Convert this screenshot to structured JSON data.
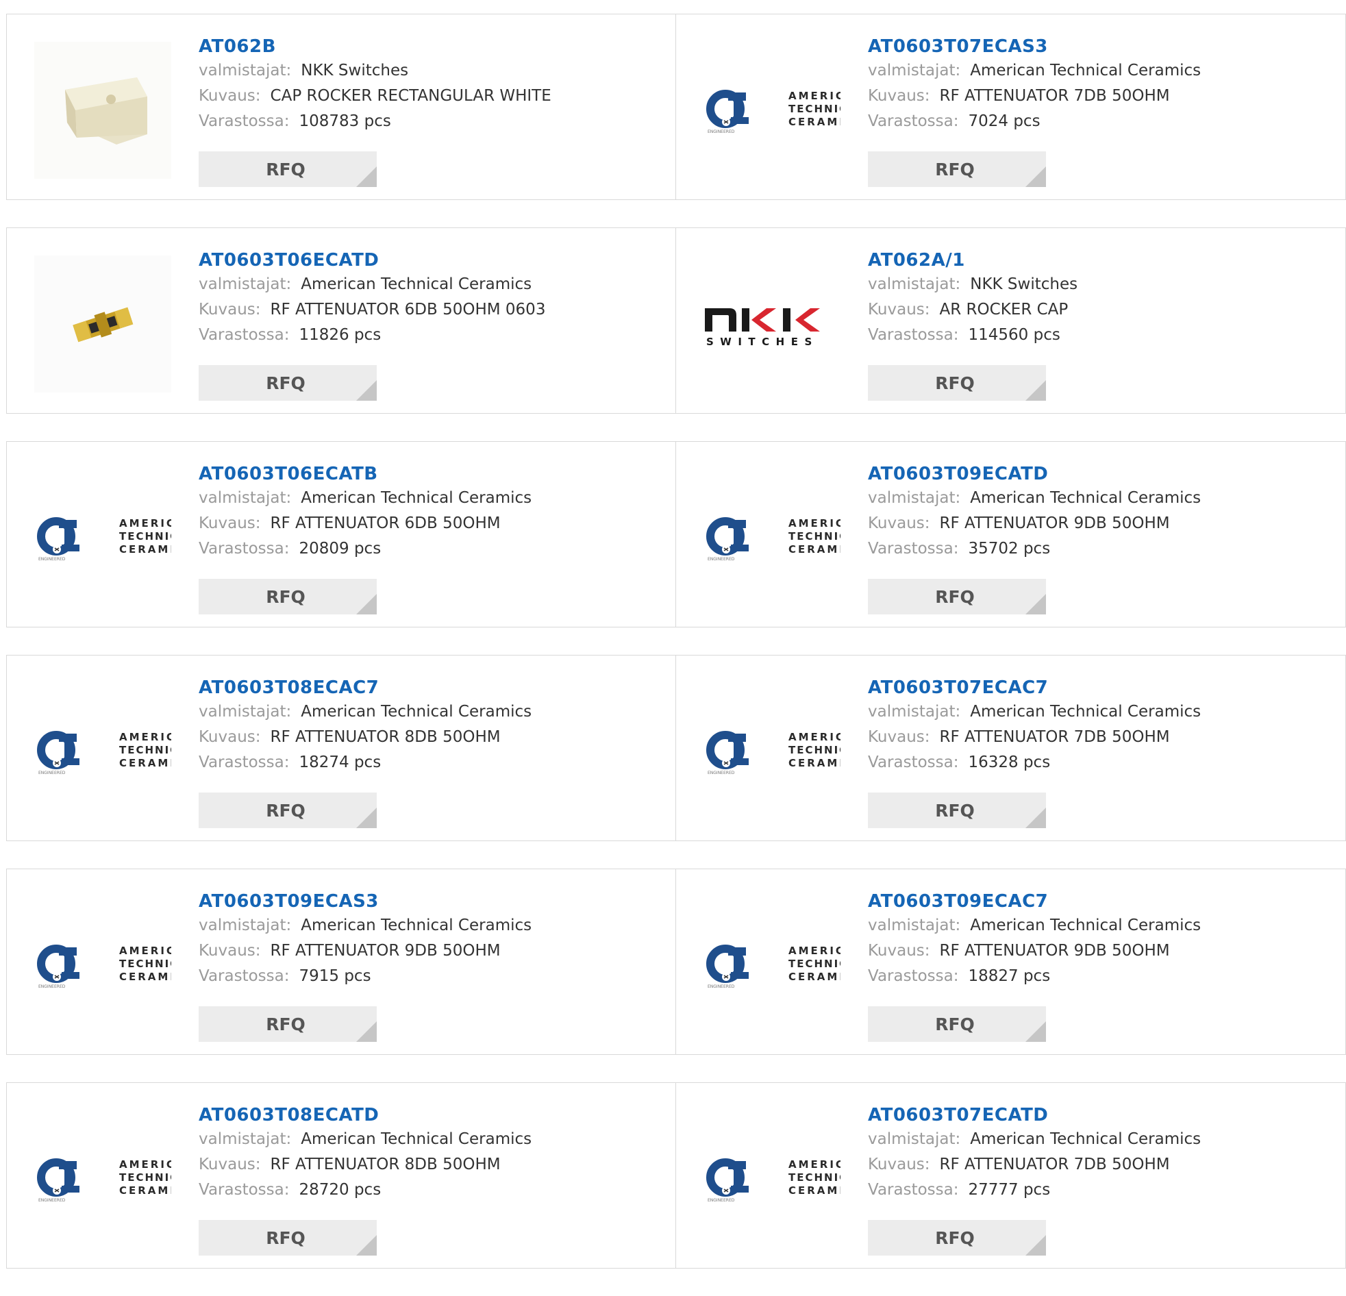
{
  "labels": {
    "manufacturer": "valmistajat:",
    "description": "Kuvaus:",
    "stock": "Varastossa:",
    "rfq": "RFQ"
  },
  "logo_text": {
    "atc": [
      "AMERICAN",
      "TECHNICAL",
      "CERAMICS"
    ],
    "nkk": "SWITCHES"
  },
  "colors": {
    "part_number": "#1565b5",
    "label": "#9a9a9a",
    "value": "#333333",
    "button_bg": "#ececec",
    "nkk_red": "#d8262f",
    "atc_blue": "#1f4e8c"
  },
  "products": [
    {
      "part": "AT062B",
      "manufacturer": "NKK Switches",
      "description": "CAP ROCKER RECTANGULAR WHITE",
      "stock": "108783 pcs",
      "image": "rocker-cap-photo"
    },
    {
      "part": "AT0603T07ECAS3",
      "manufacturer": "American Technical Ceramics",
      "description": "RF ATTENUATOR 7DB 50OHM",
      "stock": "7024 pcs",
      "image": "atc-logo"
    },
    {
      "part": "AT0603T06ECATD",
      "manufacturer": "American Technical Ceramics",
      "description": "RF ATTENUATOR 6DB 50OHM 0603",
      "stock": "11826 pcs",
      "image": "chip-attenuator-photo"
    },
    {
      "part": "AT062A/1",
      "manufacturer": "NKK Switches",
      "description": "AR ROCKER CAP",
      "stock": "114560 pcs",
      "image": "nkk-logo"
    },
    {
      "part": "AT0603T06ECATB",
      "manufacturer": "American Technical Ceramics",
      "description": "RF ATTENUATOR 6DB 50OHM",
      "stock": "20809 pcs",
      "image": "atc-logo"
    },
    {
      "part": "AT0603T09ECATD",
      "manufacturer": "American Technical Ceramics",
      "description": "RF ATTENUATOR 9DB 50OHM",
      "stock": "35702 pcs",
      "image": "atc-logo"
    },
    {
      "part": "AT0603T08ECAC7",
      "manufacturer": "American Technical Ceramics",
      "description": "RF ATTENUATOR 8DB 50OHM",
      "stock": "18274 pcs",
      "image": "atc-logo"
    },
    {
      "part": "AT0603T07ECAC7",
      "manufacturer": "American Technical Ceramics",
      "description": "RF ATTENUATOR 7DB 50OHM",
      "stock": "16328 pcs",
      "image": "atc-logo"
    },
    {
      "part": "AT0603T09ECAS3",
      "manufacturer": "American Technical Ceramics",
      "description": "RF ATTENUATOR 9DB 50OHM",
      "stock": "7915 pcs",
      "image": "atc-logo"
    },
    {
      "part": "AT0603T09ECAC7",
      "manufacturer": "American Technical Ceramics",
      "description": "RF ATTENUATOR 9DB 50OHM",
      "stock": "18827 pcs",
      "image": "atc-logo"
    },
    {
      "part": "AT0603T08ECATD",
      "manufacturer": "American Technical Ceramics",
      "description": "RF ATTENUATOR 8DB 50OHM",
      "stock": "28720 pcs",
      "image": "atc-logo"
    },
    {
      "part": "AT0603T07ECATD",
      "manufacturer": "American Technical Ceramics",
      "description": "RF ATTENUATOR 7DB 50OHM",
      "stock": "27777 pcs",
      "image": "atc-logo"
    }
  ]
}
